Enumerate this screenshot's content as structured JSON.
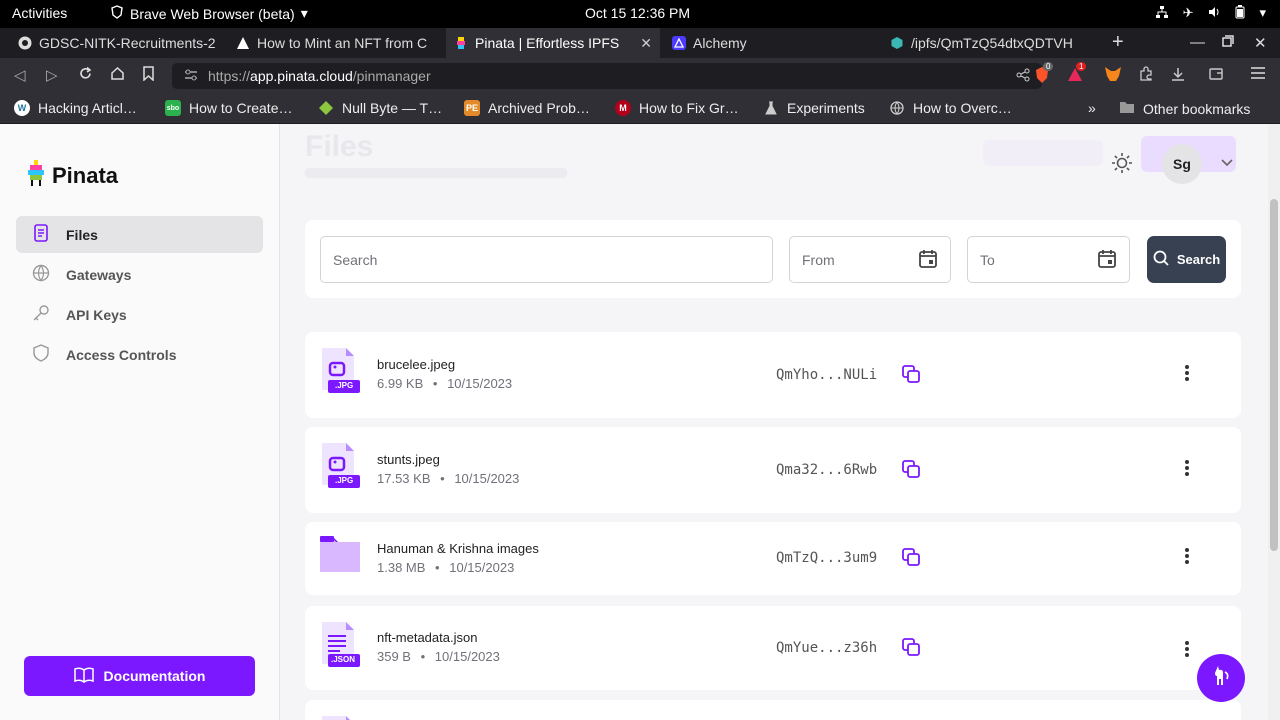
{
  "system": {
    "activities": "Activities",
    "app_name": "Brave Web Browser (beta)",
    "clock": "Oct 15  12:36 PM"
  },
  "tabs": [
    {
      "title": "GDSC-NITK-Recruitments-2",
      "active": false
    },
    {
      "title": "How to Mint an NFT from C",
      "active": false
    },
    {
      "title": "Pinata | Effortless IPFS",
      "active": true
    },
    {
      "title": "Alchemy",
      "active": false
    },
    {
      "title": "/ipfs/QmTzQ54dtxQDTVH",
      "active": false
    }
  ],
  "address": {
    "scheme": "https://",
    "host": "app.pinata.cloud",
    "path": "/pinmanager",
    "brave_shield_count": "0",
    "rewards_count": "1"
  },
  "bookmarks": [
    {
      "label": "Hacking Articl…",
      "icon": "wordpress-icon"
    },
    {
      "label": "How to Create…",
      "icon": "sbo-icon"
    },
    {
      "label": "Null Byte — T…",
      "icon": "nullbyte-icon"
    },
    {
      "label": "Archived Prob…",
      "icon": "pe-icon"
    },
    {
      "label": "How to Fix Gr…",
      "icon": "m-icon"
    },
    {
      "label": "Experiments",
      "icon": "flask-icon"
    },
    {
      "label": "How to Overc…",
      "icon": "globe-icon"
    }
  ],
  "bookmarks_more": "»",
  "other_bookmarks": "Other bookmarks",
  "sidebar": {
    "brand": "Pinata",
    "items": [
      {
        "label": "Files",
        "icon": "file-icon",
        "active": true
      },
      {
        "label": "Gateways",
        "icon": "globe-icon",
        "active": false
      },
      {
        "label": "API Keys",
        "icon": "key-icon",
        "active": false
      },
      {
        "label": "Access Controls",
        "icon": "shield-icon",
        "active": false
      }
    ],
    "documentation": "Documentation"
  },
  "header": {
    "avatar_initials": "Sg"
  },
  "search": {
    "placeholder": "Search",
    "from_placeholder": "From",
    "to_placeholder": "To",
    "button": "Search"
  },
  "files": [
    {
      "name": "brucelee.jpeg",
      "size": "6.99 KB",
      "date": "10/15/2023",
      "cid": "QmYho...NULi",
      "type": "jpg",
      "badge": ".JPG"
    },
    {
      "name": "stunts.jpeg",
      "size": "17.53 KB",
      "date": "10/15/2023",
      "cid": "Qma32...6Rwb",
      "type": "jpg",
      "badge": ".JPG"
    },
    {
      "name": "Hanuman & Krishna images",
      "size": "1.38 MB",
      "date": "10/15/2023",
      "cid": "QmTzQ...3um9",
      "type": "folder",
      "badge": ""
    },
    {
      "name": "nft-metadata.json",
      "size": "359 B",
      "date": "10/15/2023",
      "cid": "QmYue...z36h",
      "type": "json",
      "badge": ".JSON"
    }
  ],
  "meta_separator": "•",
  "colors": {
    "accent": "#7c18ff",
    "search_button": "#374151"
  }
}
